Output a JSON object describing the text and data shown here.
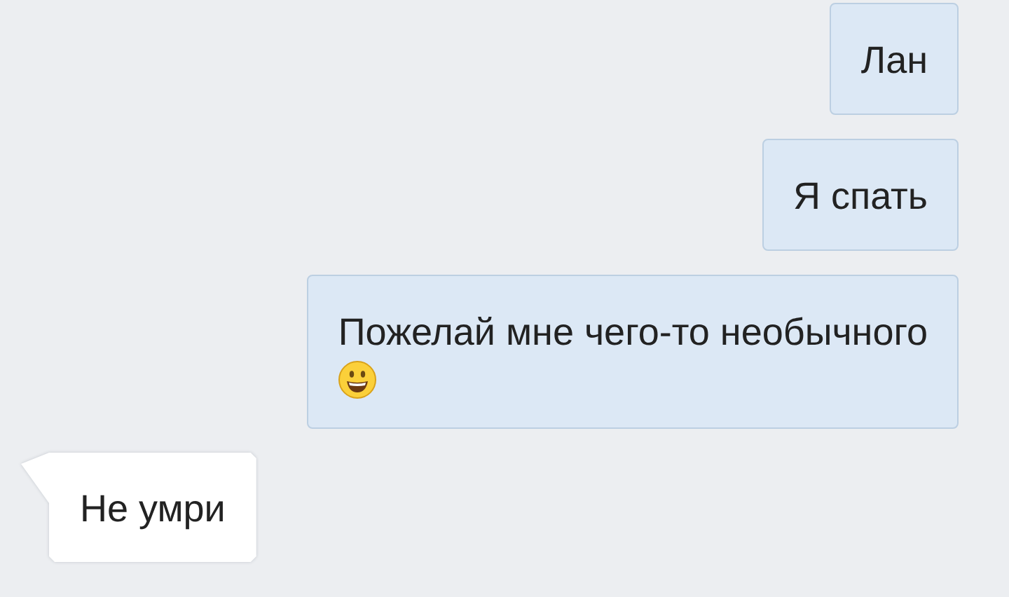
{
  "messages": [
    {
      "kind": "outgoing",
      "text": "Лан",
      "emoji": false
    },
    {
      "kind": "outgoing",
      "text": "Я спать",
      "emoji": false
    },
    {
      "kind": "outgoing",
      "text": "Пожелай мне чего-то необычного",
      "emoji": true
    },
    {
      "kind": "incoming",
      "text": "Не умри",
      "emoji": false
    }
  ]
}
